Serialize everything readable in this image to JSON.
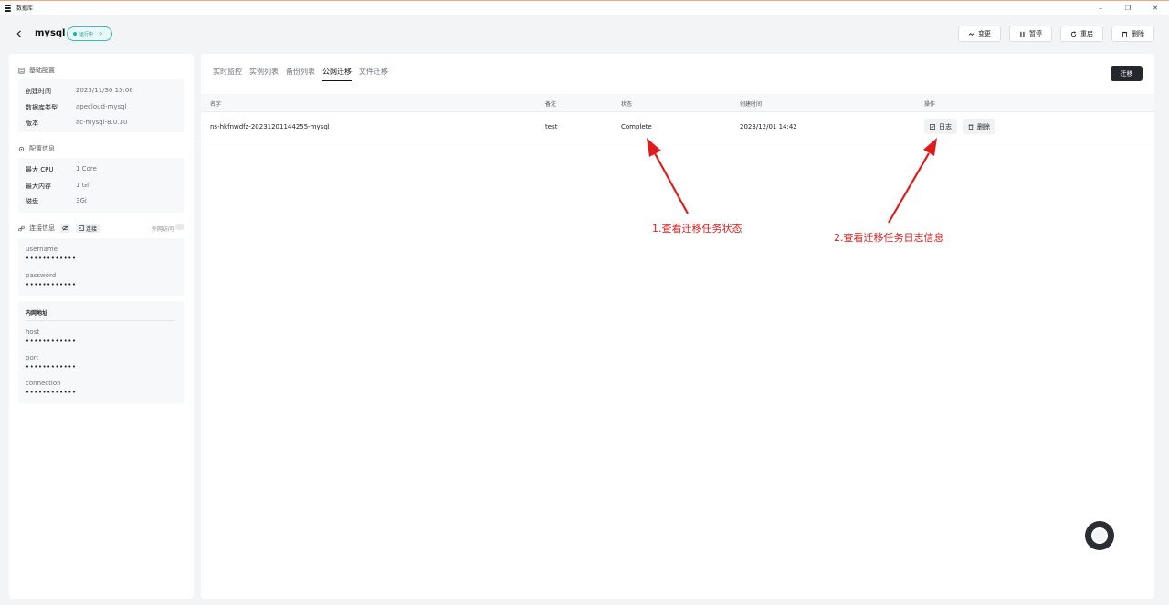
{
  "window": {
    "title": "数据库",
    "controls": [
      "–",
      "❐",
      "✕"
    ]
  },
  "header": {
    "name": "mysql",
    "status": "运行中",
    "actions": [
      {
        "id": "change",
        "label": "变更",
        "icon": "switch-icon"
      },
      {
        "id": "pause",
        "label": "暂停",
        "icon": "pause-icon"
      },
      {
        "id": "restart",
        "label": "重启",
        "icon": "restart-icon"
      },
      {
        "id": "delete",
        "label": "删除",
        "icon": "trash-icon"
      }
    ]
  },
  "sidebar": {
    "basic": {
      "title": "基础配置",
      "rows": [
        {
          "key": "创建时间",
          "value": "2023/11/30 15:06"
        },
        {
          "key": "数据库类型",
          "value": "apecloud-mysql"
        },
        {
          "key": "版本",
          "value": "ac-mysql-8.0.30"
        }
      ]
    },
    "config": {
      "title": "配置信息",
      "rows": [
        {
          "key": "最大 CPU",
          "value": "1 Core"
        },
        {
          "key": "最大内存",
          "value": "1 Gi"
        },
        {
          "key": "磁盘",
          "value": "3Gi"
        }
      ]
    },
    "connection": {
      "title": "连接信息",
      "connect_label": "连接",
      "external_label": "外网访问",
      "credentials": [
        {
          "key": "username",
          "value": "••••••••••••"
        },
        {
          "key": "password",
          "value": "••••••••••••"
        }
      ]
    },
    "internal": {
      "title": "内网地址",
      "rows": [
        {
          "key": "host",
          "value": "••••••••••••"
        },
        {
          "key": "port",
          "value": "••••••••••••"
        },
        {
          "key": "connection",
          "value": "••••••••••••"
        }
      ]
    }
  },
  "main": {
    "tabs": [
      "实时监控",
      "实例列表",
      "备份列表",
      "公网迁移",
      "文件迁移"
    ],
    "active_tab": "公网迁移",
    "primary_button": "迁移",
    "table": {
      "headers": [
        "名字",
        "备注",
        "状态",
        "创建时间",
        "操作"
      ],
      "rows": [
        {
          "name": "ns-hkfnwdfz-20231201144255-mysql",
          "remark": "test",
          "status": "Complete",
          "created": "2023/12/01 14:42",
          "log_label": "日志",
          "delete_label": "删除"
        }
      ]
    }
  },
  "annotations": {
    "first": "1.查看迁移任务状态",
    "second": "2.查看迁移任务日志信息",
    "color": "#e01b1b"
  }
}
